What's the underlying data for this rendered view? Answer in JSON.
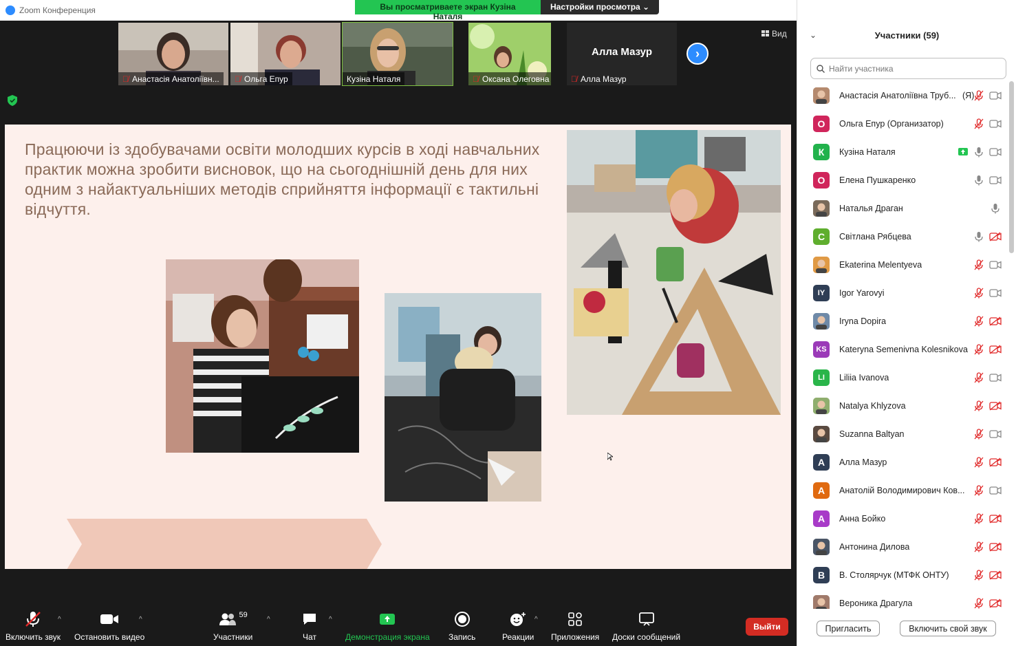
{
  "window": {
    "app_title": "Zoom Конференция",
    "share_banner": "Вы просматриваете экран Кузіна Наталя",
    "view_settings": "Настройки просмотра"
  },
  "videos": {
    "thumbnails": [
      {
        "name": "Анастасія Анатоліївн..."
      },
      {
        "name": "Ольга Епур"
      },
      {
        "name": "Кузіна Наталя"
      },
      {
        "name": "Оксана Олеговна"
      },
      {
        "name": "Алла Мазур",
        "big_name": "Алла Мазур"
      }
    ],
    "view_label": "Вид"
  },
  "slide": {
    "text": "Працюючи із здобувачами освіти молодших курсів в ході навчальних практик можна зробити висновок, що на сьогоднішній день для них одним з найактуальніших методів сприйняття інформації є тактильні відчуття."
  },
  "toolbar": {
    "unmute": "Включить звук",
    "stop_video": "Остановить видео",
    "participants": "Участники",
    "participants_count": "59",
    "chat": "Чат",
    "share_screen": "Демонстрация экрана",
    "record": "Запись",
    "reactions": "Реакции",
    "apps": "Приложения",
    "whiteboards": "Доски сообщений",
    "leave": "Выйти"
  },
  "panel": {
    "title": "Участники (59)",
    "search_placeholder": "Найти участника",
    "participants": [
      {
        "name": "Анастасія Анатоліївна Труб...",
        "suffix": "(Я)",
        "avatar": "photo",
        "color": "#b58a6e",
        "mic": "muted",
        "cam": "on"
      },
      {
        "name": "Ольга Епур (Организатор)",
        "avatar": "О",
        "color": "#d0255b",
        "mic": "muted",
        "cam": "on"
      },
      {
        "name": "Кузіна Наталя",
        "avatar": "К",
        "color": "#22b24c",
        "mic": "on",
        "cam": "on",
        "sharing": true
      },
      {
        "name": "Елена Пушкаренко",
        "avatar": "О",
        "color": "#d0255b",
        "mic": "on",
        "cam": "on"
      },
      {
        "name": "Наталья Драган",
        "avatar": "photo",
        "color": "#7a6a5a",
        "mic": "on",
        "cam": "none"
      },
      {
        "name": "Світлана Рябцева",
        "avatar": "С",
        "color": "#5fae2e",
        "mic": "on",
        "cam": "off"
      },
      {
        "name": "Ekaterina Melentyeva",
        "avatar": "photo",
        "color": "#e09a45",
        "mic": "muted",
        "cam": "on"
      },
      {
        "name": "Igor Yarovyi",
        "avatar": "IY",
        "color": "#2f3e55",
        "mic": "muted",
        "cam": "on"
      },
      {
        "name": "Iryna Dopira",
        "avatar": "photo",
        "color": "#6f8aa8",
        "mic": "muted",
        "cam": "off"
      },
      {
        "name": "Kateryna Semenivna Kolesnikova",
        "avatar": "KS",
        "color": "#9b3bb8",
        "mic": "muted",
        "cam": "off"
      },
      {
        "name": "Liliia Ivanova",
        "avatar": "LI",
        "color": "#2ab54a",
        "mic": "muted",
        "cam": "on"
      },
      {
        "name": "Natalya Khlyzova",
        "avatar": "photo",
        "color": "#8fae6e",
        "mic": "muted",
        "cam": "off"
      },
      {
        "name": "Suzanna Baltyan",
        "avatar": "photo",
        "color": "#5a4a40",
        "mic": "muted",
        "cam": "on"
      },
      {
        "name": "Алла Мазур",
        "avatar": "А",
        "color": "#2f3e55",
        "mic": "muted",
        "cam": "off"
      },
      {
        "name": "Анатолій Володимирович Ков...",
        "avatar": "А",
        "color": "#e06a10",
        "mic": "muted",
        "cam": "on"
      },
      {
        "name": "Анна Бойко",
        "avatar": "А",
        "color": "#a83bc8",
        "mic": "muted",
        "cam": "off"
      },
      {
        "name": "Антонина Дилова",
        "avatar": "photo",
        "color": "#4a5566",
        "mic": "muted",
        "cam": "off"
      },
      {
        "name": "В. Столярчук (МТФК ОНТУ)",
        "avatar": "В",
        "color": "#2f3e55",
        "mic": "muted",
        "cam": "off"
      },
      {
        "name": "Вероника Драгула",
        "avatar": "photo",
        "color": "#a07a6a",
        "mic": "muted",
        "cam": "off"
      }
    ],
    "invite": "Пригласить",
    "unmute_self": "Включить свой звук"
  }
}
